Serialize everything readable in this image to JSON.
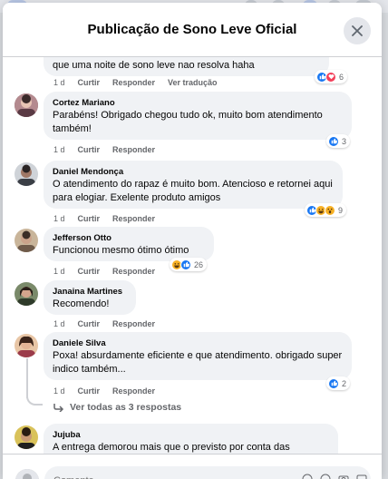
{
  "modal": {
    "title": "Publicação de Sono Leve Oficial"
  },
  "comments": [
    {
      "text": "que uma noite de sono leve nao resolva haha",
      "time": "1 d",
      "like": "Curtir",
      "reply": "Responder",
      "translate": "Ver tradução",
      "reaction_count": "6",
      "reactions": [
        "like-icon",
        "love-icon"
      ]
    },
    {
      "author": "Cortez Mariano",
      "text": "Parabéns! Obrigado chegou tudo ok, muito bom atendimento também!",
      "time": "1 d",
      "like": "Curtir",
      "reply": "Responder",
      "reaction_count": "3",
      "reactions": [
        "like-icon"
      ]
    },
    {
      "author": "Daniel Mendonça",
      "text": "O atendimento do rapaz é muito bom. Atencioso e retornei aqui para elogiar. Exelente produto amigos",
      "time": "1 d",
      "like": "Curtir",
      "reply": "Responder",
      "reaction_count": "9",
      "reactions": [
        "like-icon",
        "haha-icon",
        "wow-icon"
      ]
    },
    {
      "author": "Jefferson Otto",
      "text": "Funcionou mesmo ótimo ótimo",
      "time": "1 d",
      "like": "Curtir",
      "reply": "Responder",
      "reaction_count": "26",
      "reactions": [
        "haha-icon",
        "like-icon"
      ]
    },
    {
      "author": "Janaina Martines",
      "text": "Recomendo!",
      "time": "1 d",
      "like": "Curtir",
      "reply": "Responder"
    },
    {
      "author": "Daniele Silva",
      "text": "Poxa! absurdamente eficiente e que atendimento. obrigado super indico também...",
      "time": "1 d",
      "like": "Curtir",
      "reply": "Responder",
      "reaction_count": "2",
      "reactions": [
        "like-icon"
      ],
      "view_replies": "Ver todas as 3 respostas"
    },
    {
      "author": "Jujuba",
      "text": "A entrega demorou mais que o previsto por conta das"
    }
  ],
  "composer": {
    "placeholder": "Comente..."
  },
  "colors": {
    "like": "#1877f2",
    "love": "#f33e58",
    "haha": "#f7b125",
    "bubble": "#f0f2f5",
    "meta": "#65676b"
  }
}
